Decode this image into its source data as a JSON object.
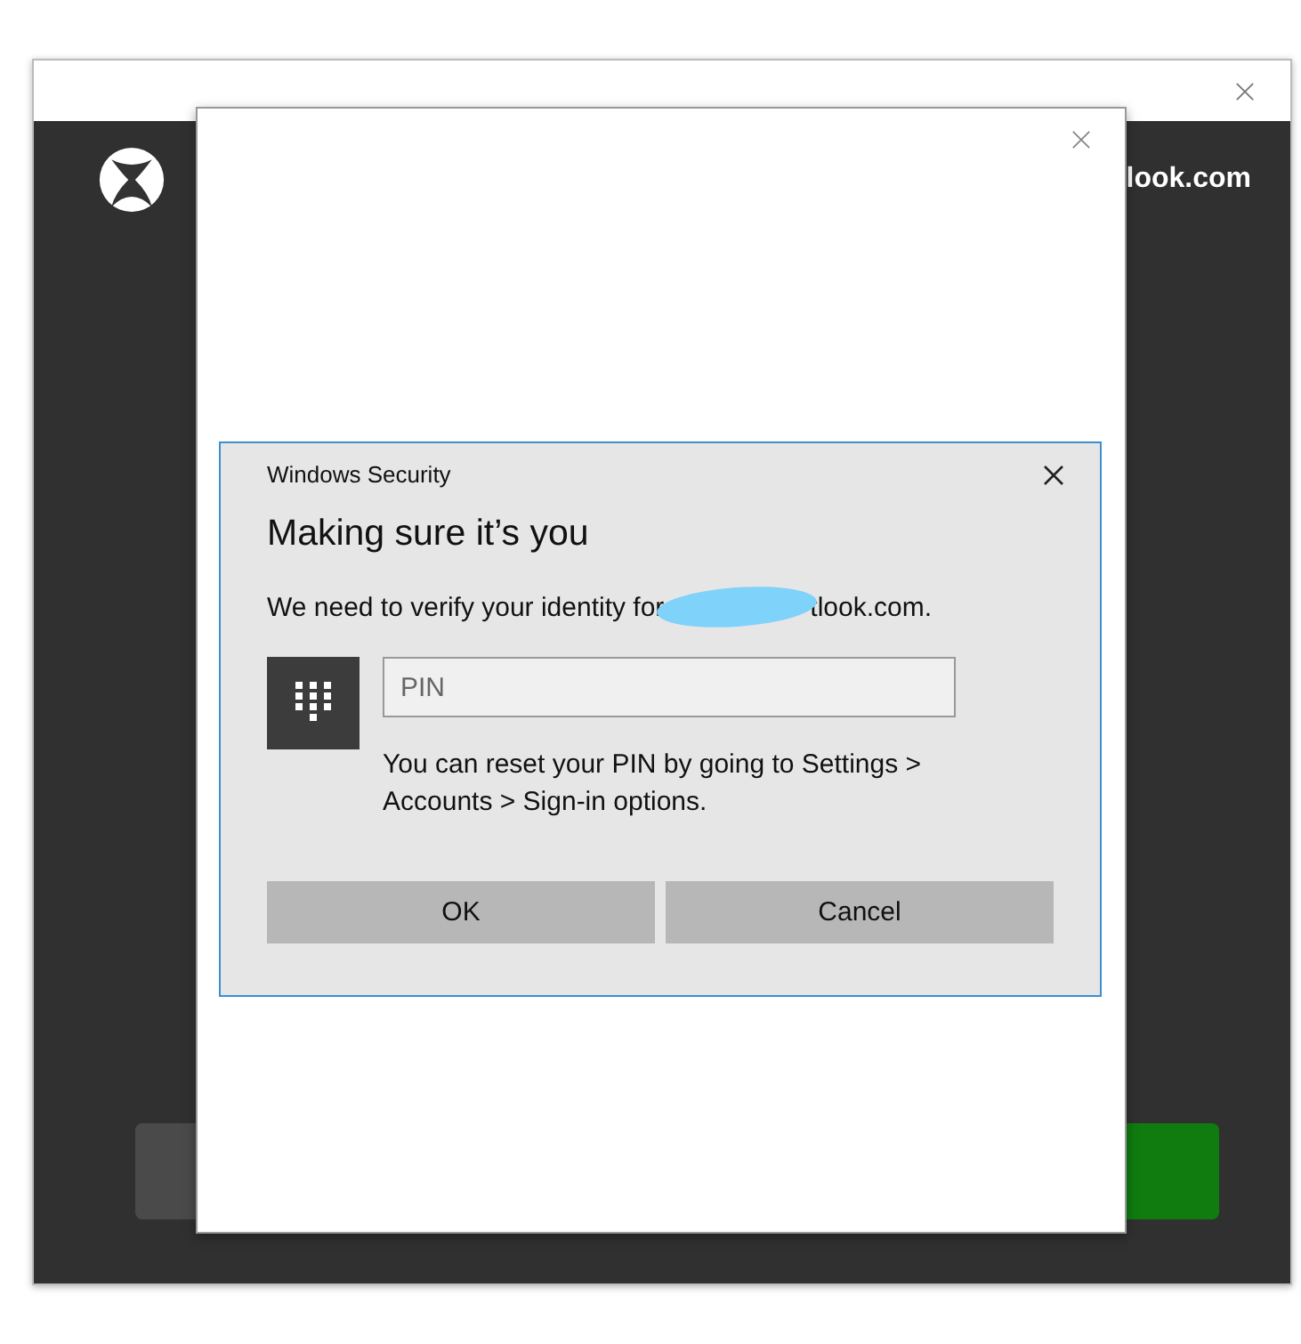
{
  "background_window": {
    "account_text": "look.com"
  },
  "dialog": {
    "title": "Windows Security",
    "heading": "Making sure it’s you",
    "message_start": "We need to verify your identity for",
    "message_end": "tlook.com.",
    "pin_field": {
      "placeholder": "PIN"
    },
    "help": "You can reset your PIN by going to Settings > Accounts > Sign-in options.",
    "buttons": [
      "OK",
      "Cancel"
    ]
  }
}
